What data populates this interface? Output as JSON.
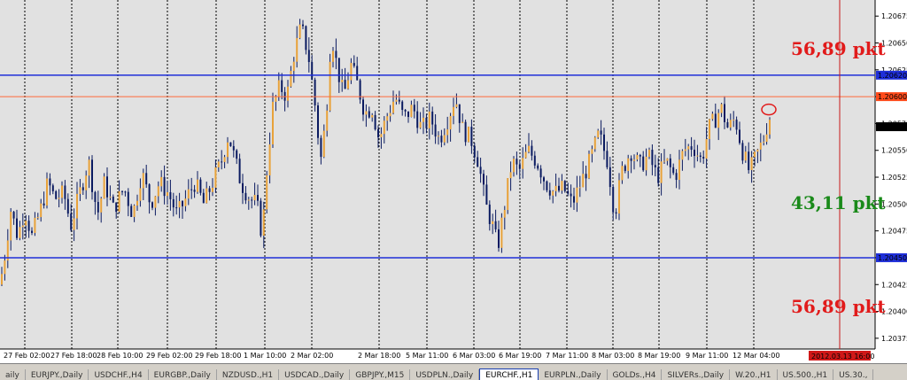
{
  "chart_data": {
    "type": "candlestick",
    "timeframe": "H1",
    "symbol": "EURCHF",
    "x_labels": [
      "27 Feb 02:00",
      "27 Feb 18:00",
      "28 Feb 10:00",
      "29 Feb 02:00",
      "29 Feb 18:00",
      "1 Mar 10:00",
      "2 Mar 02:00",
      "2 Mar 18:00",
      "5 Mar 11:00",
      "6 Mar 03:00",
      "6 Mar 19:00",
      "7 Mar 11:00",
      "8 Mar 03:00",
      "8 Mar 19:00",
      "9 Mar 11:00",
      "12 Mar 04:00"
    ],
    "y_ticks": [
      "1.20675",
      "1.20650",
      "1.20625",
      "1.20600",
      "1.20575",
      "1.20550",
      "1.20525",
      "1.20500",
      "1.20475",
      "1.20450",
      "1.20425",
      "1.20400",
      "1.20375"
    ],
    "ylim": [
      1.20365,
      1.2069
    ],
    "price_labels": [
      {
        "text": "1.20620",
        "value": 1.2062,
        "color": "#1f2fd8"
      },
      {
        "text": "1.20600",
        "value": 1.206,
        "color": "#ff4a1a"
      },
      {
        "text": "1.20572",
        "value": 1.20572,
        "color": "#000000"
      },
      {
        "text": "1.20450",
        "value": 1.2045,
        "color": "#1f2fd8"
      }
    ],
    "hlines": [
      {
        "value": 1.2062,
        "color": "#1f2fd8"
      },
      {
        "value": 1.206,
        "color": "#ff6a3a"
      },
      {
        "value": 1.2045,
        "color": "#1f2fd8"
      }
    ],
    "vline_date_label": "2012.03.13 16:00",
    "annotations": [
      {
        "text": "56,89 pkt",
        "color": "#e11b1b",
        "pos": "top-right"
      },
      {
        "text": "43,11 pkt",
        "color": "#1a8a1a",
        "pos": "middle-right"
      },
      {
        "text": "56,89 pkt",
        "color": "#e11b1b",
        "pos": "bottom-right"
      }
    ],
    "circle_marker": {
      "value": 1.20588,
      "color": "#e11b1b"
    },
    "grid": true,
    "series_keypoints": [
      [
        0,
        1.20425
      ],
      [
        6,
        1.20455
      ],
      [
        12,
        1.20495
      ],
      [
        20,
        1.2047
      ],
      [
        28,
        1.20495
      ],
      [
        36,
        1.2047
      ],
      [
        46,
        1.20495
      ],
      [
        54,
        1.2052
      ],
      [
        62,
        1.20505
      ],
      [
        72,
        1.2051
      ],
      [
        80,
        1.2048
      ],
      [
        90,
        1.2051
      ],
      [
        100,
        1.2054
      ],
      [
        110,
        1.2049
      ],
      [
        118,
        1.2052
      ],
      [
        128,
        1.20495
      ],
      [
        140,
        1.20515
      ],
      [
        150,
        1.2049
      ],
      [
        160,
        1.2053
      ],
      [
        170,
        1.205
      ],
      [
        180,
        1.2052
      ],
      [
        190,
        1.2051
      ],
      [
        200,
        1.2049
      ],
      [
        210,
        1.20505
      ],
      [
        220,
        1.2052
      ],
      [
        230,
        1.205
      ],
      [
        240,
        1.2052
      ],
      [
        250,
        1.2054
      ],
      [
        258,
        1.20565
      ],
      [
        264,
        1.20545
      ],
      [
        272,
        1.2052
      ],
      [
        282,
        1.20505
      ],
      [
        290,
        1.205
      ],
      [
        296,
        1.2047
      ],
      [
        302,
        1.2054
      ],
      [
        308,
        1.2059
      ],
      [
        316,
        1.2061
      ],
      [
        324,
        1.206
      ],
      [
        332,
        1.2064
      ],
      [
        340,
        1.20665
      ],
      [
        348,
        1.2064
      ],
      [
        356,
        1.2059
      ],
      [
        362,
        1.2054
      ],
      [
        368,
        1.2058
      ],
      [
        374,
        1.2066
      ],
      [
        380,
        1.2063
      ],
      [
        388,
        1.206
      ],
      [
        396,
        1.2063
      ],
      [
        404,
        1.2061
      ],
      [
        412,
        1.20585
      ],
      [
        420,
        1.2059
      ],
      [
        428,
        1.2056
      ],
      [
        436,
        1.2058
      ],
      [
        446,
        1.206
      ],
      [
        456,
        1.2058
      ],
      [
        466,
        1.2059
      ],
      [
        476,
        1.2057
      ],
      [
        486,
        1.2058
      ],
      [
        496,
        1.2056
      ],
      [
        506,
        1.2058
      ],
      [
        514,
        1.206
      ],
      [
        522,
        1.2057
      ],
      [
        532,
        1.2056
      ],
      [
        540,
        1.2054
      ],
      [
        548,
        1.205
      ],
      [
        556,
        1.2048
      ],
      [
        562,
        1.2046
      ],
      [
        570,
        1.205
      ],
      [
        578,
        1.2054
      ],
      [
        586,
        1.2053
      ],
      [
        596,
        1.2055
      ],
      [
        606,
        1.2054
      ],
      [
        616,
        1.2052
      ],
      [
        626,
        1.2051
      ],
      [
        636,
        1.20515
      ],
      [
        646,
        1.205
      ],
      [
        656,
        1.2052
      ],
      [
        666,
        1.2054
      ],
      [
        676,
        1.20565
      ],
      [
        686,
        1.2054
      ],
      [
        694,
        1.2049
      ],
      [
        702,
        1.2053
      ],
      [
        712,
        1.2055
      ],
      [
        722,
        1.20535
      ],
      [
        732,
        1.20545
      ],
      [
        742,
        1.20525
      ],
      [
        752,
        1.2054
      ],
      [
        762,
        1.20525
      ],
      [
        772,
        1.2055
      ],
      [
        782,
        1.20555
      ],
      [
        792,
        1.2054
      ],
      [
        800,
        1.2057
      ],
      [
        808,
        1.2058
      ],
      [
        814,
        1.2059
      ],
      [
        822,
        1.2057
      ],
      [
        830,
        1.2058
      ],
      [
        838,
        1.2055
      ],
      [
        846,
        1.2053
      ],
      [
        854,
        1.20545
      ],
      [
        862,
        1.2056
      ],
      [
        868,
        1.2058
      ],
      [
        872,
        1.20585
      ]
    ]
  },
  "tabs": [
    {
      "label": "aily"
    },
    {
      "label": "EURJPY.,Daily"
    },
    {
      "label": "USDCHF.,H4"
    },
    {
      "label": "EURGBP.,Daily"
    },
    {
      "label": "NZDUSD.,H1"
    },
    {
      "label": "USDCAD.,Daily"
    },
    {
      "label": "GBPJPY.,M15"
    },
    {
      "label": "USDPLN.,Daily"
    },
    {
      "label": "EURCHF.,H1",
      "active": true
    },
    {
      "label": "EURPLN.,Daily"
    },
    {
      "label": "GOLDs.,H4"
    },
    {
      "label": "SILVERs.,Daily"
    },
    {
      "label": "W.20.,H1"
    },
    {
      "label": "US.500.,H1"
    },
    {
      "label": "US.30.,"
    }
  ],
  "colors": {
    "background": "#e1e1e1",
    "bull": "#e8a23a",
    "bear": "#0a1a60",
    "grid": "#000000"
  }
}
